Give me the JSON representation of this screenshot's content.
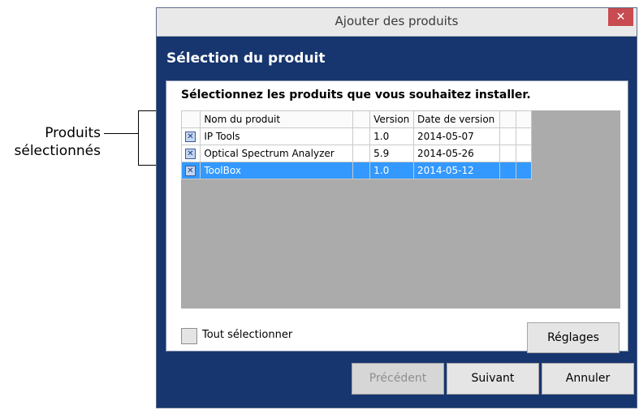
{
  "callout": {
    "line1": "Produits",
    "line2": "sélectionnés"
  },
  "window": {
    "title": "Ajouter des produits",
    "close_glyph": "✕"
  },
  "heading": "Sélection du produit",
  "instruction": "Sélectionnez les produits que vous souhaitez installer.",
  "table": {
    "headers": [
      "Nom du produit",
      "Version",
      "Date de version"
    ],
    "rows": [
      {
        "name": "IP Tools",
        "version": "1.0",
        "date": "2014-05-07",
        "checked": true,
        "selected": false
      },
      {
        "name": "Optical Spectrum Analyzer",
        "version": "5.9",
        "date": "2014-05-26",
        "checked": true,
        "selected": false
      },
      {
        "name": "ToolBox",
        "version": "1.0",
        "date": "2014-05-12",
        "checked": true,
        "selected": true
      }
    ]
  },
  "select_all_label": "Tout sélectionner",
  "buttons": {
    "settings": "Réglages",
    "previous": "Précédent",
    "next": "Suivant",
    "cancel": "Annuler"
  },
  "colors": {
    "window_bg": "#17366f",
    "selection": "#3399ff",
    "close": "#c74b50"
  }
}
